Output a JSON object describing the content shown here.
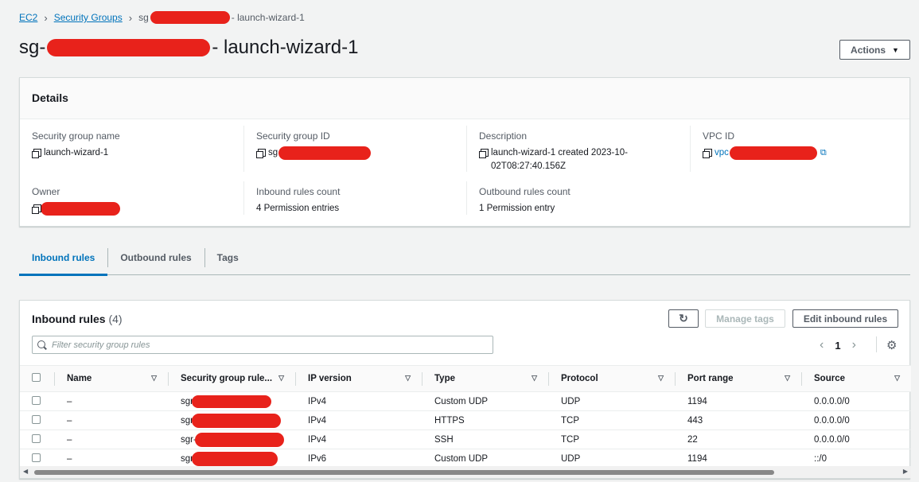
{
  "breadcrumb": {
    "root": "EC2",
    "parent": "Security Groups",
    "current_prefix": "sg",
    "current_suffix": "- launch-wizard-1"
  },
  "title": {
    "prefix": "sg-",
    "suffix": "- launch-wizard-1"
  },
  "actions_label": "Actions",
  "details": {
    "heading": "Details",
    "fields": {
      "sg_name_label": "Security group name",
      "sg_name_value": "launch-wizard-1",
      "sg_id_label": "Security group ID",
      "sg_id_prefix": "sg",
      "description_label": "Description",
      "description_value": "launch-wizard-1 created 2023-10-02T08:27:40.156Z",
      "vpc_label": "VPC ID",
      "vpc_prefix": "vpc",
      "owner_label": "Owner",
      "inbound_count_label": "Inbound rules count",
      "inbound_count_value": "4 Permission entries",
      "outbound_count_label": "Outbound rules count",
      "outbound_count_value": "1 Permission entry"
    }
  },
  "tabs": [
    "Inbound rules",
    "Outbound rules",
    "Tags"
  ],
  "rules": {
    "title": "Inbound rules",
    "count": "(4)",
    "manage_tags": "Manage tags",
    "edit_rules": "Edit inbound rules",
    "filter_placeholder": "Filter security group rules",
    "page": "1",
    "columns": [
      "Name",
      "Security group rule...",
      "IP version",
      "Type",
      "Protocol",
      "Port range",
      "Source"
    ],
    "rows": [
      {
        "name": "–",
        "rule_id": "sgr",
        "ip_version": "IPv4",
        "type": "Custom UDP",
        "protocol": "UDP",
        "port": "1194",
        "source": "0.0.0.0/0"
      },
      {
        "name": "–",
        "rule_id": "sgr",
        "ip_version": "IPv4",
        "type": "HTTPS",
        "protocol": "TCP",
        "port": "443",
        "source": "0.0.0.0/0"
      },
      {
        "name": "–",
        "rule_id": "sgr-",
        "ip_version": "IPv4",
        "type": "SSH",
        "protocol": "TCP",
        "port": "22",
        "source": "0.0.0.0/0"
      },
      {
        "name": "–",
        "rule_id": "sgr",
        "ip_version": "IPv6",
        "type": "Custom UDP",
        "protocol": "UDP",
        "port": "1194",
        "source": "::/0"
      }
    ]
  },
  "colors": {
    "link": "#0073bb",
    "redaction": "#e8221b",
    "background": "#f2f3f3"
  }
}
